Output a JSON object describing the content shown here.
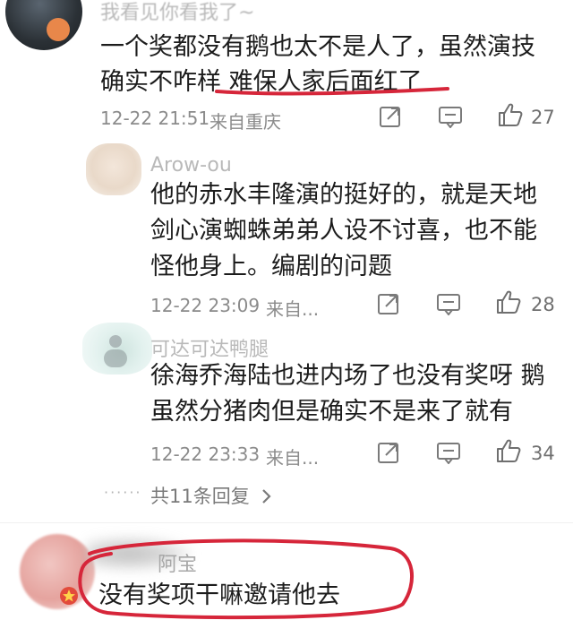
{
  "comments": [
    {
      "username": "我看见你看我了~",
      "text_lines": [
        "一个奖都没有鹅也太不是人了，虽然演技",
        "确实不咋样 难保人家后面红了"
      ],
      "time": "12-22 21:51",
      "source": "来自重庆",
      "likes": "27"
    },
    {
      "username": "Arow-ou",
      "text_lines": [
        "他的赤水丰隆演的挺好的，就是天地",
        "剑心演蜘蛛弟弟人设不讨喜，也不能",
        "怪他身上。编剧的问题"
      ],
      "time": "12-22 23:09",
      "source": "来自...",
      "likes": "28"
    },
    {
      "username": "可达可达鸭腿",
      "text_lines": [
        "徐海乔海陆也进内场了也没有奖呀 鹅",
        "虽然分猪肉但是确实不是来了就有"
      ],
      "time": "12-22 23:33",
      "source": "来自...",
      "likes": "34"
    }
  ],
  "more_replies": "共11条回复",
  "bottom_comment": {
    "username": "阿宝",
    "text": "没有奖项干嘛邀请他去"
  },
  "icons": {
    "share": "share-icon",
    "comment": "comment-icon",
    "like": "thumb-up-icon",
    "more": "ellipsis-icon",
    "chevron": "chevron-right-icon",
    "badge": "star-badge-icon"
  },
  "colors": {
    "annotation_red": "#d6263a",
    "meta_gray": "#8b8b8b",
    "link_gray": "#7a7a7a"
  }
}
